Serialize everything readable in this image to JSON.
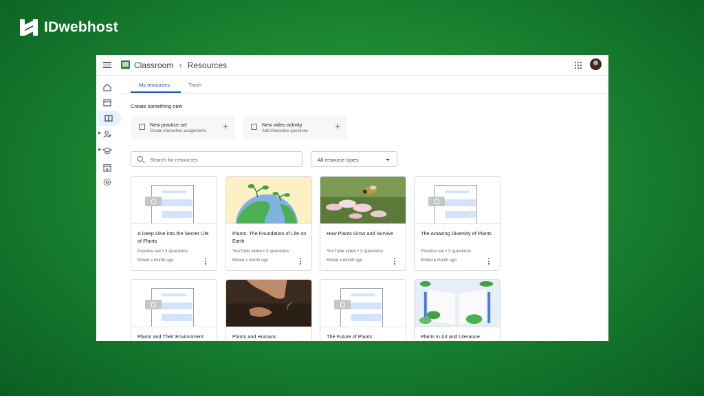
{
  "brand": {
    "name": "IDwebhost"
  },
  "header": {
    "app_name": "Classroom",
    "breadcrumb_sep": "›",
    "page": "Resources"
  },
  "rail": [
    "home-icon",
    "calendar-icon",
    "resources-icon",
    "people-icon",
    "school-icon",
    "archive-icon",
    "settings-icon"
  ],
  "tabs": [
    {
      "label": "My resources",
      "active": true
    },
    {
      "label": "Trash",
      "active": false
    }
  ],
  "create": {
    "title": "Create something new",
    "cards": [
      {
        "title": "New practice set",
        "subtitle": "Create interactive assignments"
      },
      {
        "title": "New video activity",
        "subtitle": "Add interactive questions"
      }
    ]
  },
  "search": {
    "placeholder": "Search for resources"
  },
  "filter": {
    "selected": "All resource types"
  },
  "resources": [
    {
      "title": "A Deep Dive into the Secret Life of Plants",
      "meta": "Practice set  •  3 questions",
      "edited": "Edited a month ago"
    },
    {
      "title": "Plants: The Foundation of Life on Earth",
      "meta": "YouTube video  •  3 questions",
      "edited": "Edited a month ago"
    },
    {
      "title": "How Plants Grow and Survive",
      "meta": "YouTube video  •  3 questions",
      "edited": "Edited a month ago"
    },
    {
      "title": "The Amazing Diversity of Plants",
      "meta": "Practice set  •  3 questions",
      "edited": "Edited a month ago"
    },
    {
      "title": "Plants and Their Environment",
      "meta": "",
      "edited": ""
    },
    {
      "title": "Plants and Humans",
      "meta": "",
      "edited": ""
    },
    {
      "title": "The Future of Plants",
      "meta": "",
      "edited": ""
    },
    {
      "title": "Plants in Art and Literature",
      "meta": "",
      "edited": ""
    }
  ],
  "colors": {
    "accent": "#1a57b0",
    "background_green": "#1f8a35"
  }
}
